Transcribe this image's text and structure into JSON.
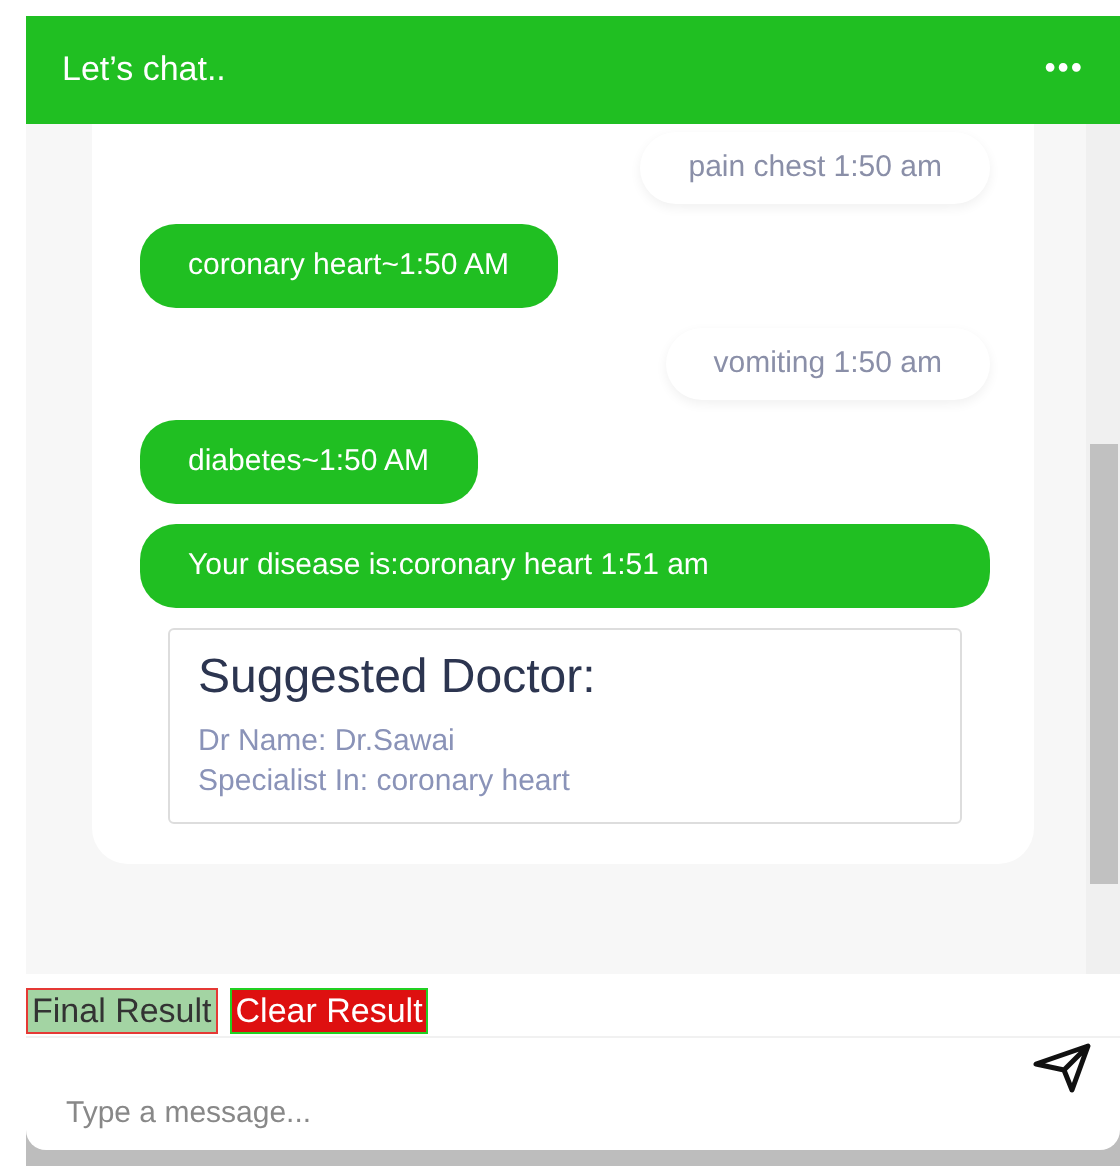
{
  "header": {
    "title": "Let’s chat..",
    "menu": "•••"
  },
  "messages": [
    {
      "kind": "user",
      "text": "pain chest 1:50 am"
    },
    {
      "kind": "bot",
      "text": "coronary heart~1:50 AM"
    },
    {
      "kind": "user",
      "text": "vomiting 1:50 am"
    },
    {
      "kind": "bot",
      "text": "diabetes~1:50 AM"
    },
    {
      "kind": "bot",
      "text": "Your disease is:coronary heart 1:51 am"
    }
  ],
  "doctor": {
    "title": "Suggested Doctor:",
    "lines": [
      "Dr Name: Dr.Sawai",
      "Specialist In: coronary heart"
    ]
  },
  "buttons": [
    {
      "label": "Final Result",
      "kind": "final"
    },
    {
      "label": "Clear Result",
      "kind": "clear"
    }
  ],
  "input": {
    "placeholder": "Type a message..."
  }
}
